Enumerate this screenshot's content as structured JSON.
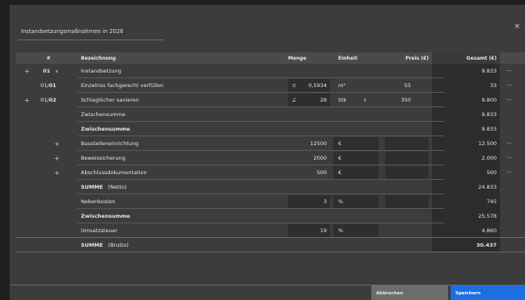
{
  "dialog": {
    "title": "Instandsetzungsmaßnahmen in 2026",
    "close": "×"
  },
  "header": {
    "nr": "#",
    "bezeichnung": "Bezeichnung",
    "menge": "Menge",
    "einheit": "Einheit",
    "preis": "Preis (€)",
    "gesamt": "Gesamt (€)"
  },
  "rows": {
    "r1": {
      "nr": "01",
      "caret": "∨",
      "bez": "Instandsetzung",
      "gesamt": "9.833",
      "more": "···"
    },
    "r2": {
      "nr_a": "01/",
      "nr_b": "01",
      "bez": "Einzelriss fachgerecht verfüllen",
      "menge_icon": "≡",
      "menge": "0,5934",
      "einheit": "m²",
      "preis": "55",
      "gesamt": "33",
      "more": "···"
    },
    "r3": {
      "plus": "+",
      "nr_a": "01/",
      "nr_b": "02",
      "bez": "Schlaglöcher sanieren",
      "menge_icon": "∠",
      "menge": "28",
      "einheit": "Stk",
      "einheit_caret": "∨",
      "preis": "350",
      "gesamt": "9.800",
      "more": "···"
    },
    "r4": {
      "bez": "Zwischensumme",
      "gesamt": "9.833"
    },
    "r5": {
      "bez": "Zwischensumme",
      "gesamt": "9.833"
    },
    "r6": {
      "plus": "+",
      "bez": "Baustelleneinrichtung",
      "menge": "12500",
      "einheit": "€",
      "gesamt": "12.500",
      "more": "···"
    },
    "r7": {
      "plus": "+",
      "bez": "Beweissicherung",
      "menge": "2000",
      "einheit": "€",
      "gesamt": "2.000",
      "more": "···"
    },
    "r8": {
      "plus": "+",
      "bez": "Abschlussdokumentation",
      "menge": "500",
      "einheit": "€",
      "gesamt": "500",
      "more": "···"
    },
    "r9": {
      "bez": "SUMME",
      "suffix": "(Netto)",
      "gesamt": "24.833"
    },
    "r10": {
      "bez": "Nebenkosten",
      "menge": "3",
      "einheit": "%",
      "gesamt": "745"
    },
    "r11": {
      "bez": "Zwischensumme",
      "gesamt": "25.578"
    },
    "r12": {
      "bez": "Umsatzsteuer",
      "menge": "19",
      "einheit": "%",
      "gesamt": "4.860"
    },
    "r13": {
      "bez": "SUMME",
      "suffix": "(Brutto)",
      "gesamt": "30.437"
    }
  },
  "leading_plus": "+",
  "footer": {
    "cancel": "Abbrechen",
    "save": "Speichern"
  },
  "colors": {
    "accent": "#1d6fe0",
    "background": "#3c3c3c"
  }
}
